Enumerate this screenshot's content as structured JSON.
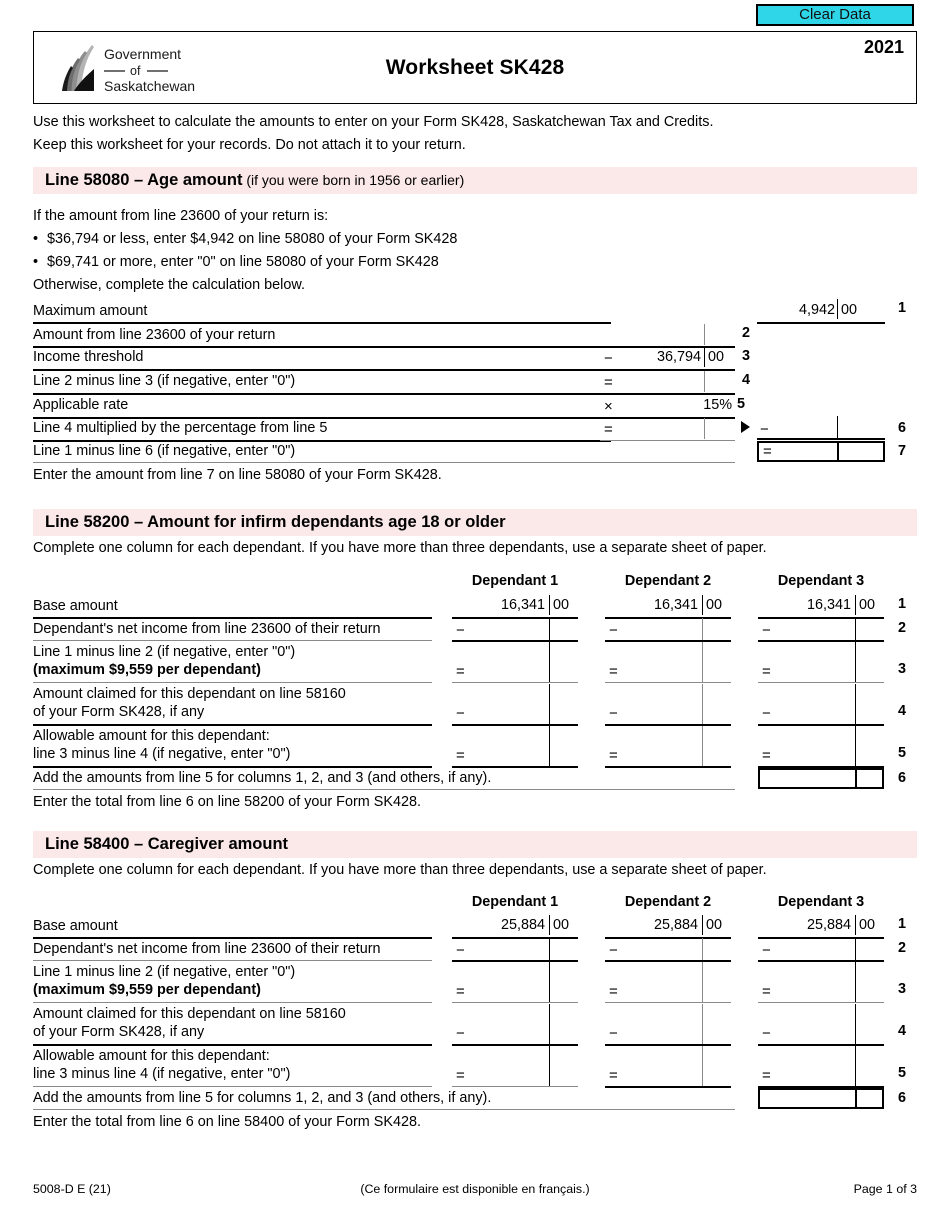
{
  "toolbar": {
    "clear_data_label": "Clear Data",
    "accent_color": "#2fd6e8"
  },
  "header": {
    "logo_line1": "Government",
    "logo_line2": "of",
    "logo_line3": "Saskatchewan",
    "title": "Worksheet SK428",
    "year": "2021",
    "banner_color": "#fbe8e8"
  },
  "intro": {
    "line1": "Use this worksheet to calculate the amounts to enter on your Form SK428, Saskatchewan Tax and Credits.",
    "line2_normal": "Keep this worksheet for your records. ",
    "line2_bold": "Do not attach it to your return."
  },
  "section1": {
    "banner_main": "Line 58080 – Age amount",
    "banner_sub": " (if you were born in 1956 or earlier)",
    "intro": "If the amount from line 23600 of your return is:",
    "bullet1_bold": "$36,794 or less",
    "bullet1_rest": ", enter $4,942 on line 58080 of your Form SK428",
    "bullet2_bold": "$69,741 or more",
    "bullet2_rest": ", enter \"0\" on line 58080 of your Form SK428",
    "otherwise": "Otherwise, complete the calculation below.",
    "rows": [
      {
        "num": "1",
        "label": "Maximum amount",
        "op": "",
        "dollars": "4,942",
        "cents": "00"
      },
      {
        "num": "2",
        "label": "Amount from line 23600 of your return",
        "op": "",
        "dollars": "",
        "cents": ""
      },
      {
        "num": "3",
        "label": "Income threshold",
        "op": "−",
        "dollars": "36,794",
        "cents": "00"
      },
      {
        "num": "4",
        "label": "Line 2 minus line 3 (if negative, enter \"0\")",
        "op": "=",
        "dollars": "",
        "cents": ""
      },
      {
        "num": "5",
        "label": "Applicable rate",
        "op": "×",
        "dollars": "15%",
        "cents": ""
      },
      {
        "num": "6",
        "label": "Line 4 multiplied by the percentage from line 5",
        "op": "=",
        "dollars": "",
        "cents": ""
      },
      {
        "num": "7",
        "label": "Line 1 minus line 6 (if negative, enter \"0\")",
        "op": "",
        "dollars": "",
        "cents": ""
      }
    ],
    "right_op_line6": "−",
    "right_op_line7": "=",
    "right_num_line6": "6",
    "right_num_line7": "7",
    "closing": "Enter the amount from line 7 on line 58080 of your Form SK428."
  },
  "section2": {
    "banner_main": "Line 58200 – Amount for infirm dependants age 18 or older",
    "instruction_pre": "Complete one column for ",
    "instruction_bold": "each",
    "instruction_post": " dependant. If you have more than three dependants, use a separate sheet of paper.",
    "column_headers": [
      "Dependant 1",
      "Dependant 2",
      "Dependant 3"
    ],
    "rows": [
      {
        "num": "1",
        "label_line1": "Base amount",
        "label_line2": "",
        "op": "",
        "dollars": "16,341",
        "cents": "00"
      },
      {
        "num": "2",
        "label_line1": "Dependant's net income from line 23600 of their return",
        "label_line2": "",
        "op": "−",
        "dollars": "",
        "cents": ""
      },
      {
        "num": "3",
        "label_line1": "Line 1 minus line 2 (if negative, enter \"0\")",
        "label_line2": "(maximum $9,559 per dependant)",
        "op": "=",
        "dollars": "",
        "cents": ""
      },
      {
        "num": "4",
        "label_line1": "Amount claimed for this dependant on line 58160",
        "label_line2": "of your Form SK428, if any",
        "op": "−",
        "dollars": "",
        "cents": ""
      },
      {
        "num": "5",
        "label_line1": "Allowable amount for this dependant:",
        "label_line2": "line 3 minus line 4 (if negative, enter \"0\")",
        "op": "=",
        "dollars": "",
        "cents": ""
      }
    ],
    "total_label": "Add the amounts from line 5 for columns 1, 2, and 3 (and others, if any).",
    "total_num": "6",
    "closing": "Enter the total from line 6 on line 58200 of your Form SK428."
  },
  "section3": {
    "banner_main": "Line 58400 – Caregiver amount",
    "instruction_pre": "Complete one column for ",
    "instruction_bold": "each",
    "instruction_post": " dependant. If you have more than three dependants, use a separate sheet of paper.",
    "column_headers": [
      "Dependant 1",
      "Dependant 2",
      "Dependant 3"
    ],
    "rows": [
      {
        "num": "1",
        "label_line1": "Base amount",
        "label_line2": "",
        "op": "",
        "dollars": "25,884",
        "cents": "00"
      },
      {
        "num": "2",
        "label_line1": "Dependant's net income from line 23600 of their return",
        "label_line2": "",
        "op": "−",
        "dollars": "",
        "cents": ""
      },
      {
        "num": "3",
        "label_line1": "Line 1 minus line 2 (if negative, enter \"0\")",
        "label_line2": "(maximum $9,559 per dependant)",
        "op": "=",
        "dollars": "",
        "cents": ""
      },
      {
        "num": "4",
        "label_line1": "Amount claimed for this dependant on line 58160",
        "label_line2": "of your Form SK428, if any",
        "op": "−",
        "dollars": "",
        "cents": ""
      },
      {
        "num": "5",
        "label_line1": "Allowable amount for this dependant:",
        "label_line2": "line 3 minus line 4 (if negative, enter \"0\")",
        "op": "=",
        "dollars": "",
        "cents": ""
      }
    ],
    "total_label": "Add the amounts from line 5 for columns 1, 2, and 3 (and others, if any).",
    "total_num": "6",
    "closing": "Enter the total from line 6 on line 58400 of your Form SK428."
  },
  "footer": {
    "left": "5008-D E (21)",
    "center": "(Ce formulaire est disponible en français.)",
    "right": "Page 1 of 3"
  }
}
